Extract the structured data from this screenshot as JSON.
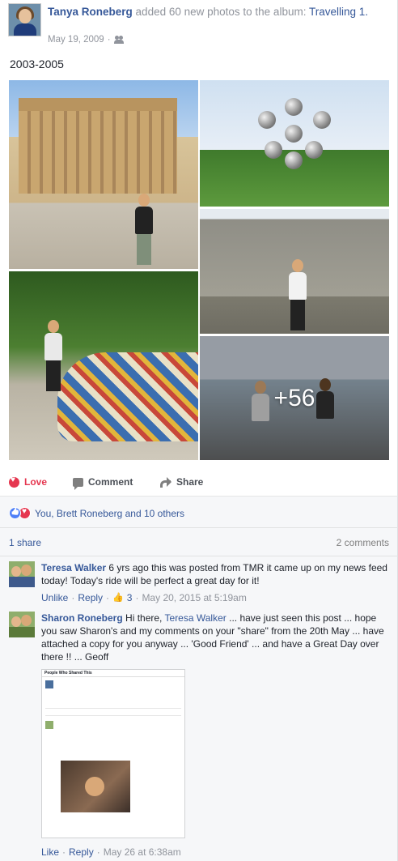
{
  "post": {
    "author": "Tanya Roneberg",
    "action": "added 60 new photos to the album:",
    "album": "Travelling 1.",
    "date": "May 19, 2009",
    "separator": "·",
    "audience_icon": "friends-icon",
    "caption": "2003-2005",
    "more_photos": "+56"
  },
  "actions": {
    "love": "Love",
    "comment": "Comment",
    "share": "Share"
  },
  "reactions": {
    "summary": "You, Brett Roneberg and 10 others",
    "shares": "1 share",
    "comments": "2 comments"
  },
  "comments": [
    {
      "name": "Teresa Walker",
      "text": "6 yrs ago this was posted from TMR it came up on my news feed today! Today's ride will be perfect a great day for it!",
      "unlike": "Unlike",
      "reply": "Reply",
      "likes": "3",
      "time": "May 20, 2015 at 5:19am"
    },
    {
      "name": "Sharon Roneberg",
      "text_1": "Hi there,",
      "mention": "Teresa Walker",
      "text_2": "... have just seen this post ... hope you saw Sharon's and my comments on your \"share\" from the 20th May ... have attached a copy for you anyway ... 'Good Friend' ... and have a Great Day over there !! ... Geoff",
      "like": "Like",
      "reply": "Reply",
      "time": "May 26 at 6:38am"
    }
  ],
  "attachment": {
    "header": "People Who Shared This"
  },
  "colors": {
    "link": "#365899",
    "love": "#e5364f",
    "meta": "#90949c"
  }
}
